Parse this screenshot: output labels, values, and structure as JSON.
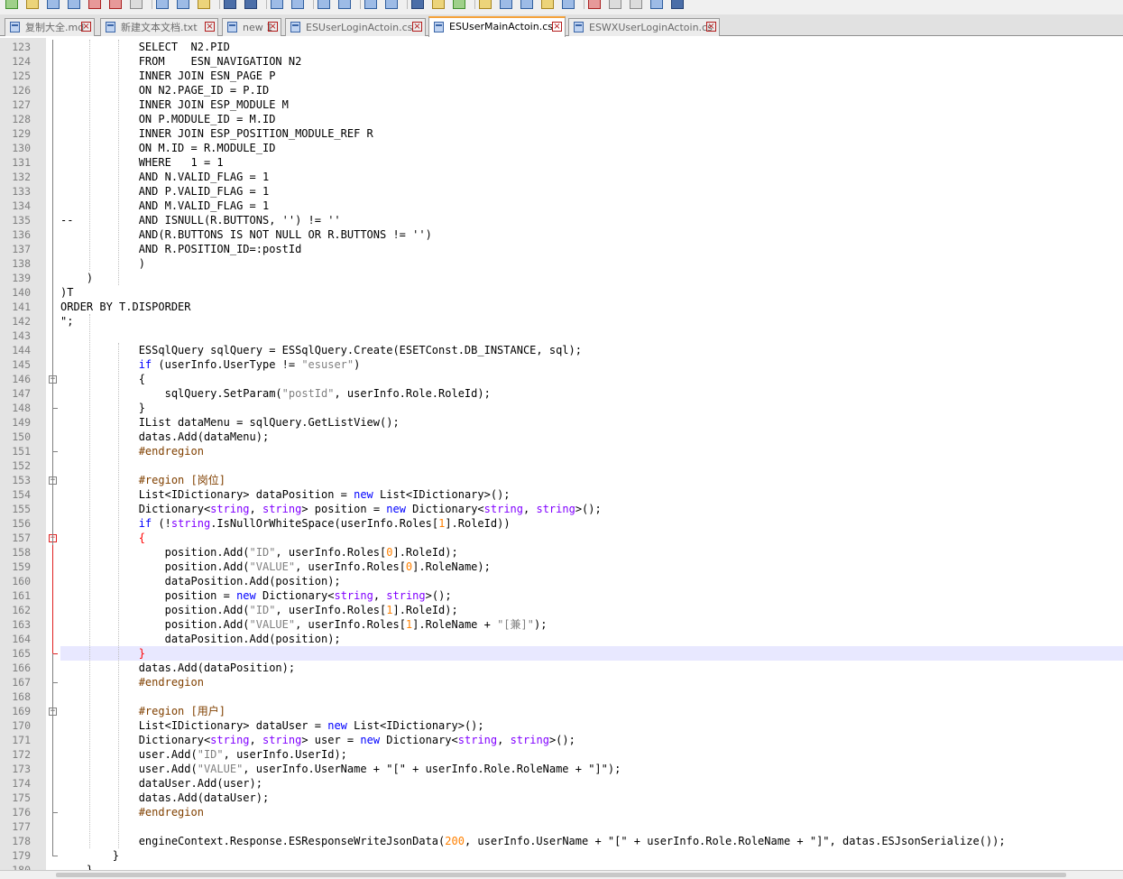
{
  "toolbar": {
    "icons": [
      "new-file-icon",
      "open-file-icon",
      "save-icon",
      "save-all-icon",
      "close-icon",
      "close-all-icon",
      "print-icon",
      "cut-icon",
      "copy-icon",
      "paste-icon",
      "undo-icon",
      "redo-icon",
      "find-icon",
      "replace-icon",
      "zoom-in-icon",
      "zoom-out-icon",
      "sync-v-icon",
      "sync-h-icon",
      "word-wrap-icon",
      "all-chars-icon",
      "indent-guide-icon",
      "udl-icon",
      "doc-map-icon",
      "function-list-icon",
      "folder-workspace-icon",
      "monitor-icon",
      "record-macro-icon",
      "stop-macro-icon",
      "play-macro-icon",
      "run-macro-icon",
      "save-macro-icon"
    ]
  },
  "tabs": [
    {
      "label": "复制大全.md",
      "active": false
    },
    {
      "label": "新建文本文档.txt",
      "active": false
    },
    {
      "label": "new 1",
      "active": false
    },
    {
      "label": "ESUserLoginActoin.cs",
      "active": false
    },
    {
      "label": "ESUserMainActoin.cs",
      "active": true
    },
    {
      "label": "ESWXUserLoginActoin.cs",
      "active": false
    }
  ],
  "tab_close_glyph": "×",
  "colors": {
    "keyword": "#0000ff",
    "string": "#808080",
    "number": "#ff8000",
    "type": "#8000ff",
    "preprocessor": "#804000",
    "current_line": "#e8e8ff",
    "active_tab_accent": "#f5a23b"
  },
  "editor": {
    "current_line": 165,
    "lines": [
      {
        "n": 123,
        "tokens": [
          {
            "t": "            SELECT  N2.PID"
          }
        ]
      },
      {
        "n": 124,
        "tokens": [
          {
            "t": "            FROM    ESN_NAVIGATION N2"
          }
        ]
      },
      {
        "n": 125,
        "tokens": [
          {
            "t": "            INNER JOIN ESN_PAGE P"
          }
        ]
      },
      {
        "n": 126,
        "tokens": [
          {
            "t": "            ON N2.PAGE_ID = P.ID"
          }
        ]
      },
      {
        "n": 127,
        "tokens": [
          {
            "t": "            INNER JOIN ESP_MODULE M"
          }
        ]
      },
      {
        "n": 128,
        "tokens": [
          {
            "t": "            ON P.MODULE_ID = M.ID"
          }
        ]
      },
      {
        "n": 129,
        "tokens": [
          {
            "t": "            INNER JOIN ESP_POSITION_MODULE_REF R"
          }
        ]
      },
      {
        "n": 130,
        "tokens": [
          {
            "t": "            ON M.ID = R.MODULE_ID"
          }
        ]
      },
      {
        "n": 131,
        "tokens": [
          {
            "t": "            WHERE   1 = 1"
          }
        ]
      },
      {
        "n": 132,
        "tokens": [
          {
            "t": "            AND N.VALID_FLAG = 1"
          }
        ]
      },
      {
        "n": 133,
        "tokens": [
          {
            "t": "            AND P.VALID_FLAG = 1"
          }
        ]
      },
      {
        "n": 134,
        "tokens": [
          {
            "t": "            AND M.VALID_FLAG = 1"
          }
        ]
      },
      {
        "n": 135,
        "tokens": [
          {
            "t": "--          AND ISNULL(R.BUTTONS, '') != ''"
          }
        ]
      },
      {
        "n": 136,
        "tokens": [
          {
            "t": "            AND(R.BUTTONS IS NOT NULL OR R.BUTTONS != '')"
          }
        ]
      },
      {
        "n": 137,
        "tokens": [
          {
            "t": "            AND R.POSITION_ID=:postId"
          }
        ]
      },
      {
        "n": 138,
        "tokens": [
          {
            "t": "            )"
          }
        ]
      },
      {
        "n": 139,
        "tokens": [
          {
            "t": "    )"
          }
        ]
      },
      {
        "n": 140,
        "tokens": [
          {
            "t": ")T"
          }
        ]
      },
      {
        "n": 141,
        "tokens": [
          {
            "t": "ORDER BY T.DISPORDER"
          }
        ]
      },
      {
        "n": 142,
        "tokens": [
          {
            "t": "\";"
          }
        ]
      },
      {
        "n": 143,
        "tokens": [
          {
            "t": ""
          }
        ]
      },
      {
        "n": 144,
        "tokens": [
          {
            "t": "            ESSqlQuery sqlQuery = ESSqlQuery.Create(ESETConst.DB_INSTANCE, sql);"
          }
        ]
      },
      {
        "n": 145,
        "tokens": [
          {
            "t": "            "
          },
          {
            "t": "if",
            "c": "k"
          },
          {
            "t": " (userInfo.UserType != "
          },
          {
            "t": "\"esuser\"",
            "c": "s"
          },
          {
            "t": ")"
          }
        ]
      },
      {
        "n": 146,
        "fold": "box",
        "tokens": [
          {
            "t": "            {"
          }
        ]
      },
      {
        "n": 147,
        "tokens": [
          {
            "t": "                sqlQuery.SetParam("
          },
          {
            "t": "\"postId\"",
            "c": "s"
          },
          {
            "t": ", userInfo.Role.RoleId);"
          }
        ]
      },
      {
        "n": 148,
        "fold": "end",
        "tokens": [
          {
            "t": "            }"
          }
        ]
      },
      {
        "n": 149,
        "tokens": [
          {
            "t": "            IList dataMenu = sqlQuery.GetListView();"
          }
        ]
      },
      {
        "n": 150,
        "tokens": [
          {
            "t": "            datas.Add(dataMenu);"
          }
        ]
      },
      {
        "n": 151,
        "fold": "end",
        "tokens": [
          {
            "t": "            "
          },
          {
            "t": "#endregion",
            "c": "r"
          }
        ]
      },
      {
        "n": 152,
        "tokens": [
          {
            "t": ""
          }
        ]
      },
      {
        "n": 153,
        "fold": "box",
        "tokens": [
          {
            "t": "            "
          },
          {
            "t": "#region [岗位]",
            "c": "r"
          }
        ]
      },
      {
        "n": 154,
        "tokens": [
          {
            "t": "            List<IDictionary> dataPosition = "
          },
          {
            "t": "new",
            "c": "k"
          },
          {
            "t": " List<IDictionary>();"
          }
        ]
      },
      {
        "n": 155,
        "tokens": [
          {
            "t": "            Dictionary<"
          },
          {
            "t": "string",
            "c": "p"
          },
          {
            "t": ", "
          },
          {
            "t": "string",
            "c": "p"
          },
          {
            "t": "> position = "
          },
          {
            "t": "new",
            "c": "k"
          },
          {
            "t": " Dictionary<"
          },
          {
            "t": "string",
            "c": "p"
          },
          {
            "t": ", "
          },
          {
            "t": "string",
            "c": "p"
          },
          {
            "t": ">();"
          }
        ]
      },
      {
        "n": 156,
        "tokens": [
          {
            "t": "            "
          },
          {
            "t": "if",
            "c": "k"
          },
          {
            "t": " (!"
          },
          {
            "t": "string",
            "c": "p"
          },
          {
            "t": ".IsNullOrWhiteSpace(userInfo.Roles["
          },
          {
            "t": "1",
            "c": "n"
          },
          {
            "t": "].RoleId))"
          }
        ]
      },
      {
        "n": 157,
        "fold": "boxred",
        "tokens": [
          {
            "t": "            "
          },
          {
            "t": "{",
            "c": "red"
          }
        ]
      },
      {
        "n": 158,
        "tokens": [
          {
            "t": "                position.Add("
          },
          {
            "t": "\"ID\"",
            "c": "s"
          },
          {
            "t": ", userInfo.Roles["
          },
          {
            "t": "0",
            "c": "n"
          },
          {
            "t": "].RoleId);"
          }
        ]
      },
      {
        "n": 159,
        "tokens": [
          {
            "t": "                position.Add("
          },
          {
            "t": "\"VALUE\"",
            "c": "s"
          },
          {
            "t": ", userInfo.Roles["
          },
          {
            "t": "0",
            "c": "n"
          },
          {
            "t": "].RoleName);"
          }
        ]
      },
      {
        "n": 160,
        "tokens": [
          {
            "t": "                dataPosition.Add(position);"
          }
        ]
      },
      {
        "n": 161,
        "tokens": [
          {
            "t": "                position = "
          },
          {
            "t": "new",
            "c": "k"
          },
          {
            "t": " Dictionary<"
          },
          {
            "t": "string",
            "c": "p"
          },
          {
            "t": ", "
          },
          {
            "t": "string",
            "c": "p"
          },
          {
            "t": ">();"
          }
        ]
      },
      {
        "n": 162,
        "tokens": [
          {
            "t": "                position.Add("
          },
          {
            "t": "\"ID\"",
            "c": "s"
          },
          {
            "t": ", userInfo.Roles["
          },
          {
            "t": "1",
            "c": "n"
          },
          {
            "t": "].RoleId);"
          }
        ]
      },
      {
        "n": 163,
        "tokens": [
          {
            "t": "                position.Add("
          },
          {
            "t": "\"VALUE\"",
            "c": "s"
          },
          {
            "t": ", userInfo.Roles["
          },
          {
            "t": "1",
            "c": "n"
          },
          {
            "t": "].RoleName + "
          },
          {
            "t": "\"[兼]\"",
            "c": "s"
          },
          {
            "t": ");"
          }
        ]
      },
      {
        "n": 164,
        "tokens": [
          {
            "t": "                dataPosition.Add(position);"
          }
        ]
      },
      {
        "n": 165,
        "fold": "endred",
        "tokens": [
          {
            "t": "            "
          },
          {
            "t": "}",
            "c": "red"
          }
        ]
      },
      {
        "n": 166,
        "tokens": [
          {
            "t": "            datas.Add(dataPosition);"
          }
        ]
      },
      {
        "n": 167,
        "fold": "end",
        "tokens": [
          {
            "t": "            "
          },
          {
            "t": "#endregion",
            "c": "r"
          }
        ]
      },
      {
        "n": 168,
        "tokens": [
          {
            "t": ""
          }
        ]
      },
      {
        "n": 169,
        "fold": "box",
        "tokens": [
          {
            "t": "            "
          },
          {
            "t": "#region [用户]",
            "c": "r"
          }
        ]
      },
      {
        "n": 170,
        "tokens": [
          {
            "t": "            List<IDictionary> dataUser = "
          },
          {
            "t": "new",
            "c": "k"
          },
          {
            "t": " List<IDictionary>();"
          }
        ]
      },
      {
        "n": 171,
        "tokens": [
          {
            "t": "            Dictionary<"
          },
          {
            "t": "string",
            "c": "p"
          },
          {
            "t": ", "
          },
          {
            "t": "string",
            "c": "p"
          },
          {
            "t": "> user = "
          },
          {
            "t": "new",
            "c": "k"
          },
          {
            "t": " Dictionary<"
          },
          {
            "t": "string",
            "c": "p"
          },
          {
            "t": ", "
          },
          {
            "t": "string",
            "c": "p"
          },
          {
            "t": ">();"
          }
        ]
      },
      {
        "n": 172,
        "tokens": [
          {
            "t": "            user.Add("
          },
          {
            "t": "\"ID\"",
            "c": "s"
          },
          {
            "t": ", userInfo.UserId);"
          }
        ]
      },
      {
        "n": 173,
        "tokens": [
          {
            "t": "            user.Add("
          },
          {
            "t": "\"VALUE\"",
            "c": "s"
          },
          {
            "t": ", userInfo.UserName + \"[\" + userInfo.Role.RoleName + \"]\");"
          }
        ]
      },
      {
        "n": 174,
        "tokens": [
          {
            "t": "            dataUser.Add(user);"
          }
        ]
      },
      {
        "n": 175,
        "tokens": [
          {
            "t": "            datas.Add(dataUser);"
          }
        ]
      },
      {
        "n": 176,
        "fold": "end",
        "tokens": [
          {
            "t": "            "
          },
          {
            "t": "#endregion",
            "c": "r"
          }
        ]
      },
      {
        "n": 177,
        "tokens": [
          {
            "t": ""
          }
        ]
      },
      {
        "n": 178,
        "tokens": [
          {
            "t": "            engineContext.Response.ESResponseWriteJsonData("
          },
          {
            "t": "200",
            "c": "n"
          },
          {
            "t": ", userInfo.UserName + \"[\" + userInfo.Role.RoleName + \"]\", datas.ESJsonSerialize());"
          }
        ]
      },
      {
        "n": 179,
        "fold": "end",
        "tokens": [
          {
            "t": "        }"
          }
        ]
      },
      {
        "n": 180,
        "tokens": [
          {
            "t": "    }"
          }
        ]
      }
    ]
  }
}
